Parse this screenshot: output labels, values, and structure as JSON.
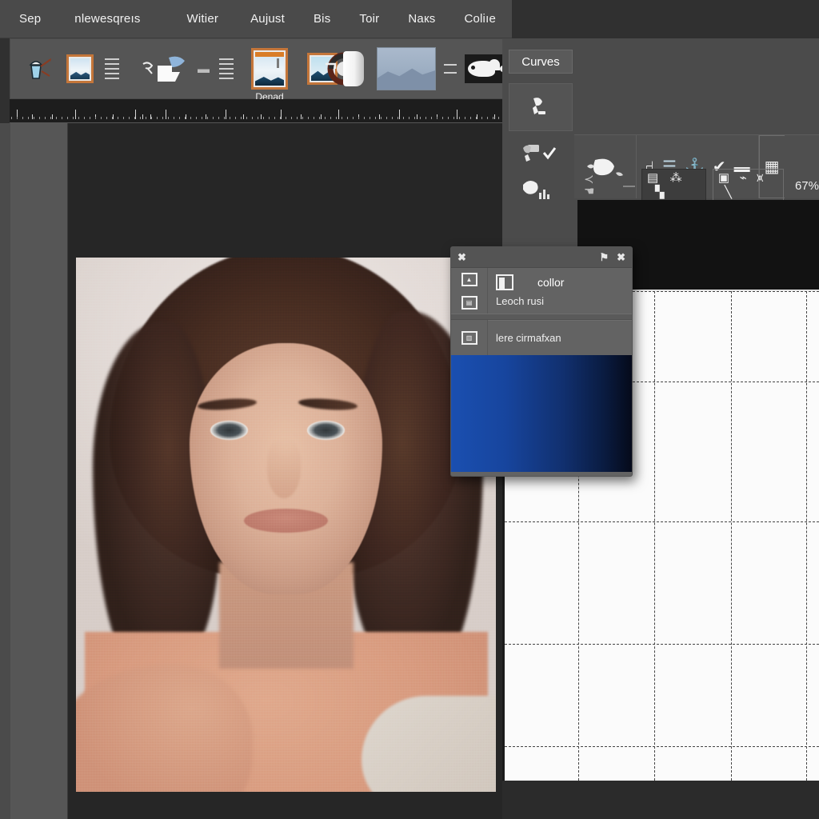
{
  "menubar": {
    "items": [
      {
        "label": "Sep",
        "name": "menu-sep"
      },
      {
        "label": "nlewesqreıs",
        "name": "menu-nlewesqrets"
      },
      {
        "label": "Witier",
        "name": "menu-witier"
      },
      {
        "label": "Aujust",
        "name": "menu-aujust"
      },
      {
        "label": "Bis",
        "name": "menu-bis"
      },
      {
        "label": "Toir",
        "name": "menu-toir"
      },
      {
        "label": "Naкs",
        "name": "menu-naxs"
      },
      {
        "label": "Coliıe",
        "name": "menu-colie"
      }
    ]
  },
  "toolbar": {
    "items": [
      {
        "name": "tool-paint-bucket",
        "icon": "paint-bucket-icon",
        "label": ""
      },
      {
        "name": "tool-framed-image",
        "icon": "framed-image-icon",
        "label": ""
      },
      {
        "name": "tool-lines-list",
        "icon": "lines-list-icon",
        "label": ""
      },
      {
        "name": "tool-lasso-shape",
        "icon": "lasso-shape-icon",
        "label": ""
      },
      {
        "name": "tool-dash",
        "icon": "dash-icon",
        "label": ""
      },
      {
        "name": "tool-lines-list-2",
        "icon": "lines-list-icon",
        "label": ""
      },
      {
        "name": "tool-photo-document",
        "icon": "photo-document-icon",
        "label": "Denad"
      },
      {
        "name": "tool-photo-color-ring",
        "icon": "color-ring-icon",
        "label": ""
      },
      {
        "name": "tool-corner-marker",
        "icon": "corner-marker-icon",
        "label": ""
      },
      {
        "name": "tool-capsule",
        "icon": "capsule-icon",
        "label": ""
      },
      {
        "name": "tool-landscape-thumb",
        "icon": "landscape-thumbnail-icon",
        "label": ""
      },
      {
        "name": "tool-connector-lines",
        "icon": "connector-lines-icon",
        "label": ""
      },
      {
        "name": "tool-mask-thumb",
        "icon": "mask-thumbnail-icon",
        "label": ""
      }
    ]
  },
  "ruler": {
    "name": "horizontal-ruler",
    "tick_positions": [
      3,
      9,
      17,
      26,
      34,
      41,
      50,
      53,
      56,
      62,
      70,
      78,
      86,
      93,
      100,
      108,
      116,
      124,
      131,
      139,
      147,
      155,
      162,
      170,
      178,
      186,
      193,
      197
    ]
  },
  "right_panel": {
    "curves_tab": "Curves",
    "tool_cells": [
      {
        "name": "panel-tool-clone",
        "icon": "clone-stamp-icon"
      },
      {
        "name": "panel-tool-eyedropper",
        "icon": "eyedropper-check-icon"
      },
      {
        "name": "panel-tool-smudge",
        "icon": "smudge-icon"
      }
    ],
    "options": [
      {
        "name": "option-shape-blob",
        "icon": "blob-shape-icon"
      },
      {
        "name": "option-flag-small",
        "icon": "flag-small-icon"
      },
      {
        "name": "option-align-left",
        "icon": "align-left-icon"
      },
      {
        "name": "option-anchor",
        "icon": "anchor-icon"
      },
      {
        "name": "option-check-line",
        "icon": "check-line-icon"
      },
      {
        "name": "option-table",
        "icon": "table-icon"
      }
    ],
    "options_row2": [
      {
        "name": "option-arrow-hand",
        "icon": "arrow-hand-icon"
      },
      {
        "name": "option-divider-line",
        "icon": "divider-line-icon"
      },
      {
        "name": "option-grid-cells",
        "icon": "grid-cells-icon"
      },
      {
        "name": "option-scatter",
        "icon": "scatter-icon"
      },
      {
        "name": "option-gradient-ramp",
        "icon": "gradient-ramp-icon"
      },
      {
        "name": "option-square-select",
        "icon": "square-select-icon"
      },
      {
        "name": "option-brush-stroke",
        "icon": "brush-stroke-icon"
      },
      {
        "name": "option-scribble",
        "icon": "scribble-icon"
      },
      {
        "name": "option-slash",
        "icon": "slash-icon"
      }
    ],
    "zoom_value": "67%"
  },
  "dialog": {
    "name": "color-popup-dialog",
    "title_close_left": "✖",
    "title_flag": "⚑",
    "title_close_right": "✖",
    "row1": {
      "label_main": "collor",
      "label_sub": "Leoch rusi",
      "icons": [
        "image-small-icon",
        "calculator-small-icon",
        "panel-chip-icon"
      ]
    },
    "row2": {
      "label": "lere cirmafxan",
      "icon": "layers-small-icon"
    },
    "swatch": {
      "name": "blue-gradient-swatch",
      "from": "#1a4fb0",
      "to": "#050a1a"
    }
  },
  "curves_grid": {
    "name": "curves-grid",
    "h_lines_pct": [
      0,
      18.5,
      47,
      72,
      93
    ],
    "v_lines_pct": [
      23.5,
      47.5,
      72,
      96
    ]
  },
  "canvas": {
    "name": "image-canvas",
    "photo_name": "portrait-photo"
  },
  "colors": {
    "menubar_bg": "#4a4a4a",
    "toolbar_bg": "#555555",
    "panel_bg": "#4b4b4b",
    "canvas_bg": "#262626",
    "grid_bg": "#fbfbfb",
    "accent_orange": "#c4763a",
    "swatch_blue": "#1a4fb0"
  }
}
